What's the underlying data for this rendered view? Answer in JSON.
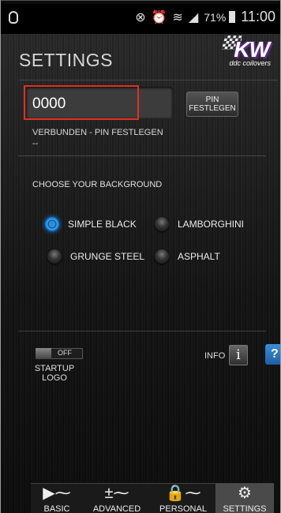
{
  "statusbar": {
    "time": "11:00",
    "battery_percent": "71%",
    "icons": [
      "notification-icon",
      "mute-icon",
      "alarm-icon",
      "wifi-icon",
      "signal-icon",
      "battery-icon"
    ]
  },
  "header": {
    "title": "SETTINGS",
    "logo_text": "KW",
    "logo_subtitle": "ddc coilovers"
  },
  "pin": {
    "value": "0000",
    "button_label": "PIN\nFESTLEGEN",
    "status": "VERBUNDEN - PIN FESTLEGEN",
    "status_detail": "--"
  },
  "background": {
    "label": "CHOOSE YOUR BACKGROUND",
    "options": [
      {
        "label": "SIMPLE BLACK",
        "selected": true
      },
      {
        "label": "LAMBORGHINI",
        "selected": false
      },
      {
        "label": "GRUNGE STEEL",
        "selected": false
      },
      {
        "label": "ASPHALT",
        "selected": false
      }
    ]
  },
  "startup": {
    "toggle_state": "OFF",
    "label": "STARTUP\nLOGO"
  },
  "info": {
    "label": "INFO",
    "button_symbol": "i",
    "help_symbol": "?"
  },
  "tabs": [
    {
      "label": "BASIC",
      "icon": "pulse-play-icon",
      "glyph": "▶⁓",
      "active": false
    },
    {
      "label": "ADVANCED",
      "icon": "plus-minus-pulse-icon",
      "glyph": "±⁓",
      "active": false
    },
    {
      "label": "PERSONAL",
      "icon": "lock-pulse-icon",
      "glyph": "🔒⁓",
      "active": false
    },
    {
      "label": "SETTINGS",
      "icon": "gear-icon",
      "glyph": "⚙",
      "active": true
    }
  ],
  "colors": {
    "accent_blue": "#1e90ff",
    "highlight_red": "#e0301e",
    "logo_purple": "#5b2c83"
  }
}
